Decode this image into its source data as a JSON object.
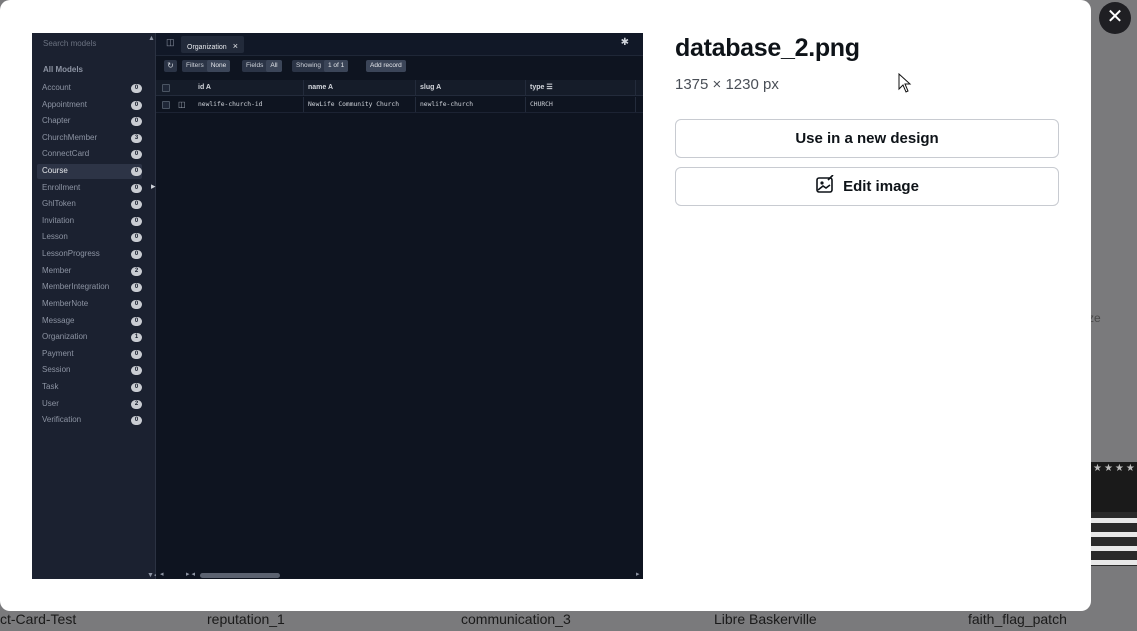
{
  "background": {
    "bottom_labels": [
      "ct-Card-Test",
      "reputation_1",
      "communication_3",
      "Libre Baskerville",
      "faith_flag_patch"
    ],
    "side_text": "ze"
  },
  "modal": {
    "close_label": "✕",
    "file_title": "database_2.png",
    "file_dimensions": "1375 × 1230 px",
    "use_button": "Use in a new design",
    "edit_button": "Edit image",
    "icons": {
      "close": "close-icon",
      "edit": "image-edit-icon",
      "cursor": "mouse-pointer-icon"
    }
  },
  "preview": {
    "search_placeholder": "Search models",
    "models_heading": "All Models",
    "models": [
      {
        "name": "Account",
        "count": "0"
      },
      {
        "name": "Appointment",
        "count": "0"
      },
      {
        "name": "Chapter",
        "count": "0"
      },
      {
        "name": "ChurchMember",
        "count": "3"
      },
      {
        "name": "ConnectCard",
        "count": "0"
      },
      {
        "name": "Course",
        "count": "0",
        "active": true
      },
      {
        "name": "Enrollment",
        "count": "0"
      },
      {
        "name": "GhlToken",
        "count": "0"
      },
      {
        "name": "Invitation",
        "count": "0"
      },
      {
        "name": "Lesson",
        "count": "0"
      },
      {
        "name": "LessonProgress",
        "count": "0"
      },
      {
        "name": "Member",
        "count": "2"
      },
      {
        "name": "MemberIntegration",
        "count": "0"
      },
      {
        "name": "MemberNote",
        "count": "0"
      },
      {
        "name": "Message",
        "count": "0"
      },
      {
        "name": "Organization",
        "count": "1"
      },
      {
        "name": "Payment",
        "count": "0"
      },
      {
        "name": "Session",
        "count": "0"
      },
      {
        "name": "Task",
        "count": "0"
      },
      {
        "name": "User",
        "count": "2"
      },
      {
        "name": "Verification",
        "count": "0"
      }
    ],
    "tab_label": "Organization",
    "toolbar": {
      "filters_label": "Filters",
      "filters_value": "None",
      "fields_label": "Fields",
      "fields_value": "All",
      "showing_label": "Showing",
      "showing_value": "1 of 1",
      "add_record": "Add record"
    },
    "columns": [
      "id A",
      "name A",
      "slug A",
      "type ☰"
    ],
    "rows": [
      [
        "newlife-church-id",
        "NewLife Community Church",
        "newlife-church",
        "CHURCH"
      ]
    ]
  }
}
